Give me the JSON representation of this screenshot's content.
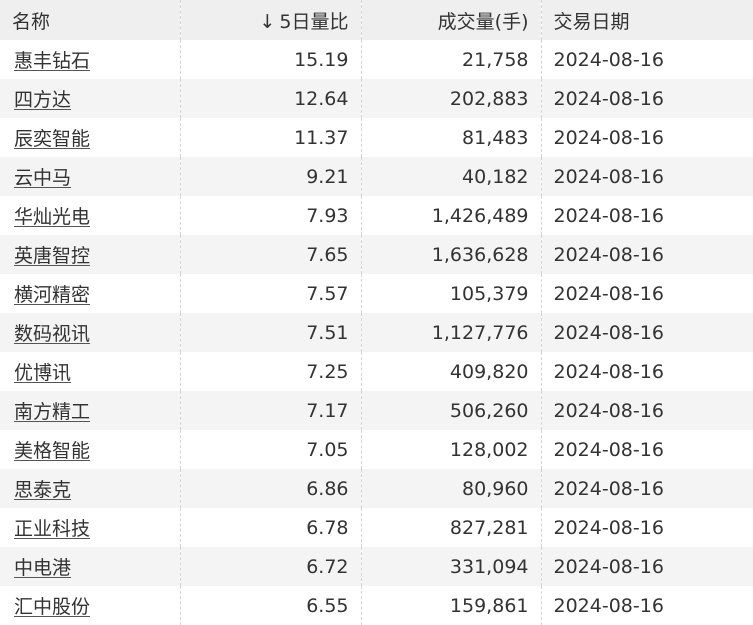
{
  "table": {
    "headers": {
      "name": "名称",
      "sort_arrow": "↓",
      "volume_ratio": "5日量比",
      "volume": "成交量(手)",
      "date": "交易日期"
    },
    "rows": [
      {
        "name": "惠丰钻石",
        "ratio": "15.19",
        "volume": "21,758",
        "date": "2024-08-16"
      },
      {
        "name": "四方达",
        "ratio": "12.64",
        "volume": "202,883",
        "date": "2024-08-16"
      },
      {
        "name": "辰奕智能",
        "ratio": "11.37",
        "volume": "81,483",
        "date": "2024-08-16"
      },
      {
        "name": "云中马",
        "ratio": "9.21",
        "volume": "40,182",
        "date": "2024-08-16"
      },
      {
        "name": "华灿光电",
        "ratio": "7.93",
        "volume": "1,426,489",
        "date": "2024-08-16"
      },
      {
        "name": "英唐智控",
        "ratio": "7.65",
        "volume": "1,636,628",
        "date": "2024-08-16"
      },
      {
        "name": "横河精密",
        "ratio": "7.57",
        "volume": "105,379",
        "date": "2024-08-16"
      },
      {
        "name": "数码视讯",
        "ratio": "7.51",
        "volume": "1,127,776",
        "date": "2024-08-16"
      },
      {
        "name": "优博讯",
        "ratio": "7.25",
        "volume": "409,820",
        "date": "2024-08-16"
      },
      {
        "name": "南方精工",
        "ratio": "7.17",
        "volume": "506,260",
        "date": "2024-08-16"
      },
      {
        "name": "美格智能",
        "ratio": "7.05",
        "volume": "128,002",
        "date": "2024-08-16"
      },
      {
        "name": "思泰克",
        "ratio": "6.86",
        "volume": "80,960",
        "date": "2024-08-16"
      },
      {
        "name": "正业科技",
        "ratio": "6.78",
        "volume": "827,281",
        "date": "2024-08-16"
      },
      {
        "name": "中电港",
        "ratio": "6.72",
        "volume": "331,094",
        "date": "2024-08-16"
      },
      {
        "name": "汇中股份",
        "ratio": "6.55",
        "volume": "159,861",
        "date": "2024-08-16"
      }
    ]
  }
}
